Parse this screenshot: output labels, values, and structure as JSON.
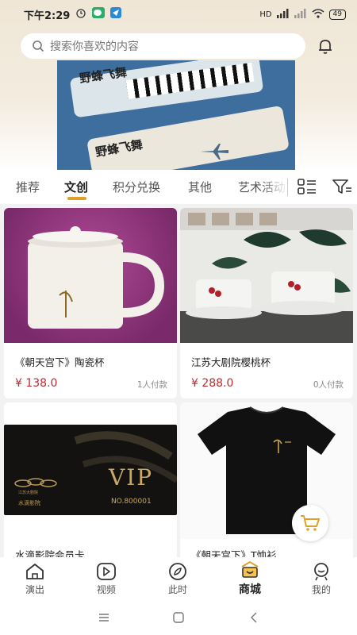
{
  "status_bar": {
    "time": "下午2:29",
    "network": "HD",
    "battery": "49"
  },
  "search": {
    "placeholder": "搜索你喜欢的内容"
  },
  "banner": {
    "calligraphy": "野蜂飞舞"
  },
  "tabs": [
    {
      "label": "推荐",
      "active": false
    },
    {
      "label": "文创",
      "active": true
    },
    {
      "label": "积分兑换",
      "active": false
    },
    {
      "label": "其他",
      "active": false
    },
    {
      "label": "艺术活动",
      "active": false
    }
  ],
  "products": [
    {
      "title": "《朝天宫下》陶瓷杯",
      "price": "¥ 138.0",
      "sold": "1人付款",
      "image": "ceramic-mug"
    },
    {
      "title": "江苏大剧院樱桃杯",
      "price": "¥ 288.0",
      "sold": "0人付款",
      "image": "cherry-cups"
    },
    {
      "title": "水滴影院会员卡",
      "price": "",
      "sold": "",
      "image": "vip-card"
    },
    {
      "title": "《朝天宫下》T恤衫",
      "price": "",
      "sold": "",
      "image": "black-tshirt"
    }
  ],
  "vip_card": {
    "vip_text": "VIP",
    "number": "NO.800001",
    "brand_line1": "江苏大剧院",
    "brand_line2": "水滴影院"
  },
  "bottom_nav": [
    {
      "label": "演出",
      "icon": "home-icon",
      "active": false
    },
    {
      "label": "视频",
      "icon": "play-icon",
      "active": false
    },
    {
      "label": "此时",
      "icon": "compass-icon",
      "active": false
    },
    {
      "label": "商城",
      "icon": "shop-icon",
      "active": true
    },
    {
      "label": "我的",
      "icon": "profile-icon",
      "active": false
    }
  ],
  "colors": {
    "accent": "#e0a12a",
    "price": "#c0282d",
    "header_bg": "#efe6d6"
  }
}
